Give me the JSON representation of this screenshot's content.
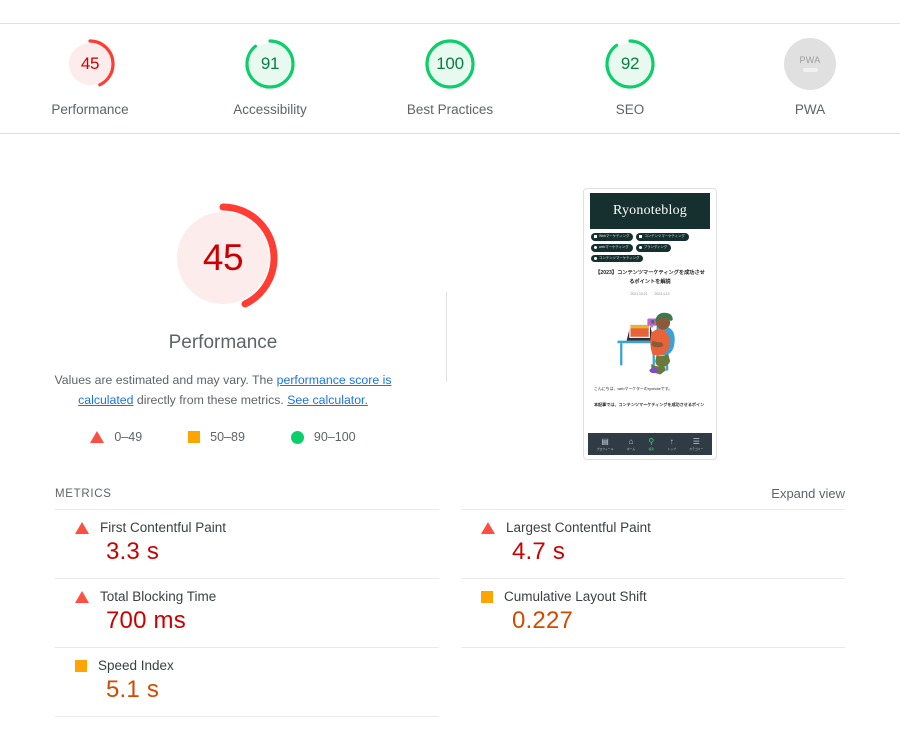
{
  "scorescale": {
    "gauges": [
      {
        "label": "Performance",
        "score": "45",
        "type": "fail",
        "pct": 45
      },
      {
        "label": "Accessibility",
        "score": "91",
        "type": "pass",
        "pct": 91
      },
      {
        "label": "Best Practices",
        "score": "100",
        "type": "pass",
        "pct": 100
      },
      {
        "label": "SEO",
        "score": "92",
        "type": "pass",
        "pct": 92
      },
      {
        "label": "PWA",
        "score": "",
        "type": "null",
        "pct": 0,
        "badge": "PWA"
      }
    ]
  },
  "performance": {
    "score": "45",
    "title": "Performance",
    "description_part1": "Values are estimated and may vary. The ",
    "link1": "performance score is calculated",
    "description_part2": " directly from these metrics. ",
    "link2": "See calculator.",
    "legend": [
      {
        "shape": "triangle",
        "range": "0–49",
        "color": "#ff4e42"
      },
      {
        "shape": "square",
        "range": "50–89",
        "color": "#ffa400"
      },
      {
        "shape": "circle",
        "range": "90–100",
        "color": "#0cce6b"
      }
    ]
  },
  "screenshot": {
    "site_name": "Ryonoteblog",
    "tags": [
      {
        "icon": "square-icon",
        "label": "Webマーケティング"
      },
      {
        "icon": "square-icon",
        "label": "コンテンツマーケティング"
      },
      {
        "icon": "circle-icon",
        "label": "webマーケティング"
      },
      {
        "icon": "circle-icon",
        "label": "ブランディング"
      },
      {
        "icon": "circle-icon",
        "label": "コンテンツマーケティング"
      }
    ],
    "article_title": "【2023】コンテンツマーケティングを成功させるポイントを解説",
    "published": "2021.10.21",
    "updated": "2023.4.12",
    "body_text": "こんにちは、webマーケターのryonoteです。",
    "body_text2": "本記事では、コンテンツマーケティングを成功させるポイン",
    "nav": [
      {
        "icon": "monitor-icon",
        "label": "プロフィール",
        "active": false
      },
      {
        "icon": "home-icon",
        "label": "ホーム",
        "active": false
      },
      {
        "icon": "search-icon",
        "label": "検索",
        "active": true
      },
      {
        "icon": "arrow-up-icon",
        "label": "トップ",
        "active": false
      },
      {
        "icon": "list-icon",
        "label": "カテゴリー",
        "active": false
      }
    ]
  },
  "metrics": {
    "heading": "METRICS",
    "expand_view": "Expand view",
    "left": [
      {
        "name": "First Contentful Paint",
        "value": "3.3 s",
        "status": "fail"
      },
      {
        "name": "Total Blocking Time",
        "value": "700 ms",
        "status": "fail"
      },
      {
        "name": "Speed Index",
        "value": "5.1 s",
        "status": "avg"
      }
    ],
    "right": [
      {
        "name": "Largest Contentful Paint",
        "value": "4.7 s",
        "status": "fail"
      },
      {
        "name": "Cumulative Layout Shift",
        "value": "0.227",
        "status": "avg"
      }
    ]
  }
}
